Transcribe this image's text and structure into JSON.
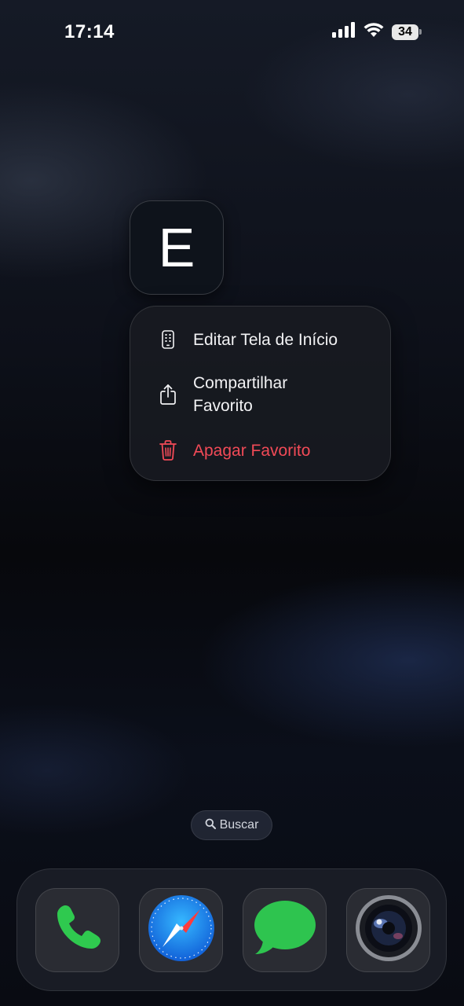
{
  "status_bar": {
    "time": "17:14",
    "battery_level": "34",
    "icons": [
      "cellular-signal-icon",
      "wifi-icon",
      "battery-icon"
    ]
  },
  "bookmark": {
    "letter": "E"
  },
  "context_menu": {
    "items": [
      {
        "label": "Editar Tela de Início",
        "icon": "phone-grid-icon",
        "destructive": false
      },
      {
        "label_line1": "Compartilhar",
        "label_line2": "Favorito",
        "icon": "share-icon",
        "destructive": false
      },
      {
        "label": "Apagar Favorito",
        "icon": "trash-icon",
        "destructive": true
      }
    ]
  },
  "search": {
    "label": "Buscar",
    "icon": "magnifier-icon"
  },
  "dock": {
    "apps": [
      {
        "icon": "phone-app-icon"
      },
      {
        "icon": "safari-app-icon"
      },
      {
        "icon": "messages-app-icon"
      },
      {
        "icon": "camera-app-icon"
      }
    ]
  },
  "colors": {
    "destructive": "#f24a57",
    "phone_green": "#2fc94f",
    "messages_green": "#2ec44f",
    "safari_blue": "#1f8ef0"
  }
}
